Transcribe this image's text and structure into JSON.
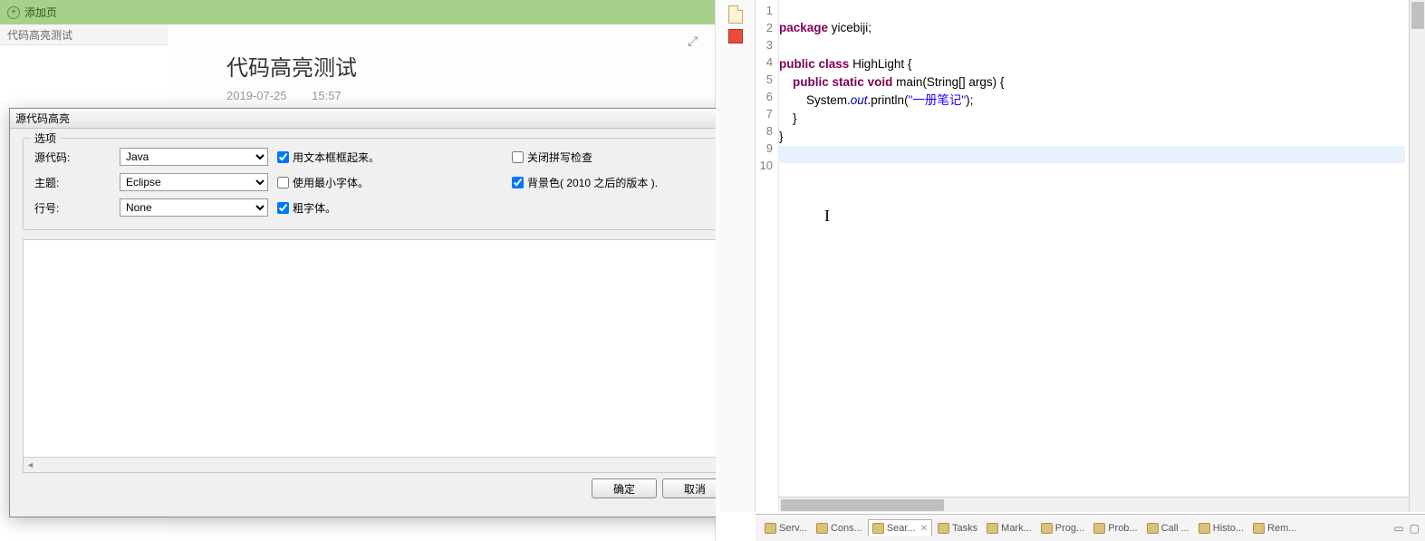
{
  "left": {
    "add_page": "添加页",
    "nav_item": "代码高亮测试",
    "note_title": "代码高亮测试",
    "note_date": "2019-07-25",
    "note_time": "15:57",
    "expand_glyph": "⤢"
  },
  "dialog": {
    "title": "源代码高亮",
    "close": "×",
    "group_label": "选项",
    "field_src": "源代码:",
    "field_theme": "主题:",
    "field_line": "行号:",
    "val_src": "Java",
    "val_theme": "Eclipse",
    "val_line": "None",
    "chk_textbox": "用文本框框起来。",
    "chk_minfont": "使用最小字体。",
    "chk_bold": "粗字体。",
    "chk_spell": "关闭拼写检查",
    "chk_bg": "背景色( 2010 之后的版本 ).",
    "btn_ok": "确定",
    "btn_cancel": "取消",
    "scroll_left": "◄",
    "scroll_right": "►"
  },
  "code": {
    "lines": [
      "1",
      "2",
      "3",
      "4",
      "5",
      "6",
      "7",
      "8",
      "9",
      "10"
    ],
    "l1_kw": "package",
    "l1_id": " yicebiji;",
    "l3_kw1": "public",
    "l3_kw2": "class",
    "l3_id": " HighLight {",
    "l4_kw1": "public",
    "l4_kw2": "static",
    "l4_kw3": "void",
    "l4_id": " main(String[] args) {",
    "l5_a": "        System.",
    "l5_out": "out",
    "l5_b": ".println(",
    "l5_str": "\"一册笔记\"",
    "l5_c": ");",
    "l6": "    }",
    "l7": "}"
  },
  "tabs": {
    "serv": "Serv...",
    "cons": "Cons...",
    "sear": "Sear...",
    "tasks": "Tasks",
    "mark": "Mark...",
    "prog": "Prog...",
    "prob": "Prob...",
    "call": "Call ...",
    "histo": "Histo...",
    "rem": "Rem..."
  }
}
